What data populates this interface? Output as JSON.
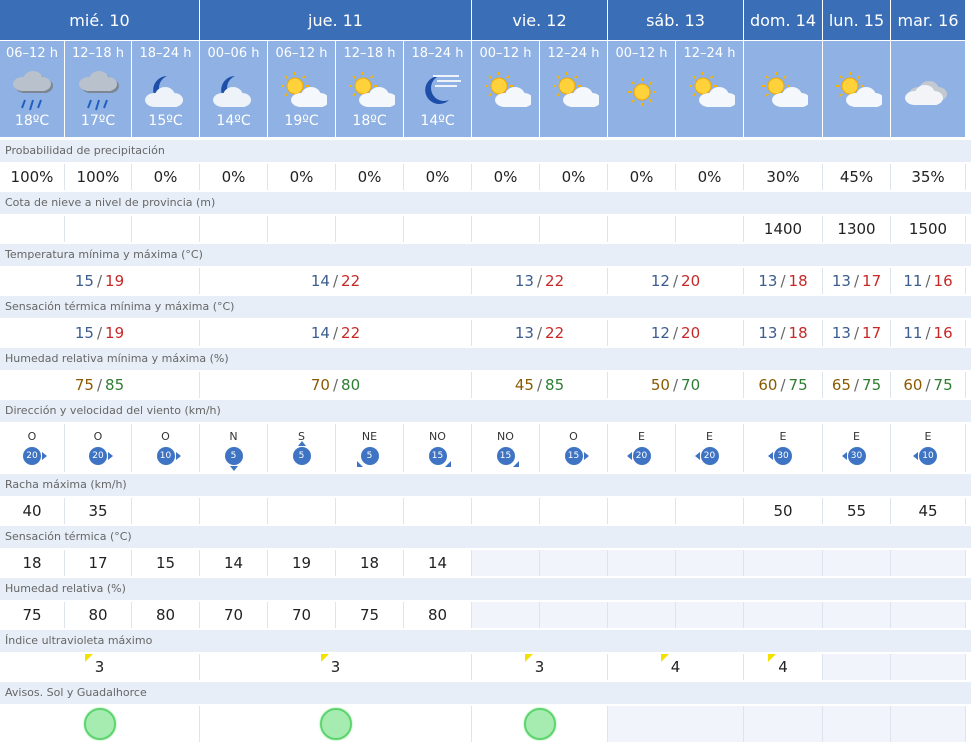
{
  "days": [
    {
      "label": "mié. 10"
    },
    {
      "label": "jue. 11"
    },
    {
      "label": "vie. 12"
    },
    {
      "label": "sáb. 13"
    },
    {
      "label": "dom. 14"
    },
    {
      "label": "lun. 15"
    },
    {
      "label": "mar. 16"
    }
  ],
  "periods": [
    {
      "label": "06–12 h",
      "temp": "18ºC",
      "icon": "rain-cloud-icon"
    },
    {
      "label": "12–18 h",
      "temp": "17ºC",
      "icon": "rain-cloud-icon"
    },
    {
      "label": "18–24 h",
      "temp": "15ºC",
      "icon": "moon-cloud-icon"
    },
    {
      "label": "00–06 h",
      "temp": "14ºC",
      "icon": "moon-cloud-icon"
    },
    {
      "label": "06–12 h",
      "temp": "19ºC",
      "icon": "sun-cloud-icon"
    },
    {
      "label": "12–18 h",
      "temp": "18ºC",
      "icon": "sun-cloud-icon"
    },
    {
      "label": "18–24 h",
      "temp": "14ºC",
      "icon": "moon-haze-icon"
    },
    {
      "label": "00–12 h",
      "temp": "",
      "icon": "sun-cloud-icon"
    },
    {
      "label": "12–24 h",
      "temp": "",
      "icon": "sun-cloud-icon"
    },
    {
      "label": "00–12 h",
      "temp": "",
      "icon": "sun-icon"
    },
    {
      "label": "12–24 h",
      "temp": "",
      "icon": "sun-cloud-icon"
    },
    {
      "label": "",
      "temp": "",
      "icon": "sun-cloud-icon"
    },
    {
      "label": "",
      "temp": "",
      "icon": "sun-cloud-icon"
    },
    {
      "label": "",
      "temp": "",
      "icon": "cloud-icon"
    }
  ],
  "labels": {
    "precip": "Probabilidad de precipitación",
    "snow": "Cota de nieve a nivel de provincia (m)",
    "temp": "Temperatura mínima y máxima (°C)",
    "feels": "Sensación térmica mínima y máxima (°C)",
    "hum": "Humedad relativa mínima y máxima (%)",
    "wind": "Dirección y velocidad del viento (km/h)",
    "gust": "Racha máxima (km/h)",
    "feel1": "Sensación térmica (°C)",
    "hum1": "Humedad relativa (%)",
    "uv": "Índice ultravioleta máximo",
    "alerts": "Avisos. Sol y Guadalhorce"
  },
  "precip": [
    "100%",
    "100%",
    "0%",
    "0%",
    "0%",
    "0%",
    "0%",
    "0%",
    "0%",
    "0%",
    "0%",
    "30%",
    "45%",
    "35%"
  ],
  "snow": [
    "",
    "",
    "",
    "",
    "",
    "",
    "",
    "",
    "",
    "",
    "",
    "1400",
    "1300",
    "1500"
  ],
  "temp": [
    {
      "min": "15",
      "max": "19"
    },
    {
      "min": "14",
      "max": "22"
    },
    {
      "min": "13",
      "max": "22"
    },
    {
      "min": "12",
      "max": "20"
    },
    {
      "min": "13",
      "max": "18"
    },
    {
      "min": "13",
      "max": "17"
    },
    {
      "min": "11",
      "max": "16"
    }
  ],
  "feels": [
    {
      "min": "15",
      "max": "19"
    },
    {
      "min": "14",
      "max": "22"
    },
    {
      "min": "13",
      "max": "22"
    },
    {
      "min": "12",
      "max": "20"
    },
    {
      "min": "13",
      "max": "18"
    },
    {
      "min": "13",
      "max": "17"
    },
    {
      "min": "11",
      "max": "16"
    }
  ],
  "hum": [
    {
      "min": "75",
      "max": "85"
    },
    {
      "min": "70",
      "max": "80"
    },
    {
      "min": "45",
      "max": "85"
    },
    {
      "min": "50",
      "max": "70"
    },
    {
      "min": "60",
      "max": "75"
    },
    {
      "min": "65",
      "max": "75"
    },
    {
      "min": "60",
      "max": "75"
    }
  ],
  "wind": [
    {
      "dir": "O",
      "speed": "20"
    },
    {
      "dir": "O",
      "speed": "20"
    },
    {
      "dir": "O",
      "speed": "10"
    },
    {
      "dir": "N",
      "speed": "5"
    },
    {
      "dir": "S",
      "speed": "5"
    },
    {
      "dir": "NE",
      "speed": "5"
    },
    {
      "dir": "NO",
      "speed": "15"
    },
    {
      "dir": "NO",
      "speed": "15"
    },
    {
      "dir": "O",
      "speed": "15"
    },
    {
      "dir": "E",
      "speed": "20"
    },
    {
      "dir": "E",
      "speed": "20"
    },
    {
      "dir": "E",
      "speed": "30"
    },
    {
      "dir": "E",
      "speed": "30"
    },
    {
      "dir": "E",
      "speed": "10"
    }
  ],
  "gust": [
    "40",
    "35",
    "",
    "",
    "",
    "",
    "",
    "",
    "",
    "",
    "",
    "50",
    "55",
    "45"
  ],
  "feel1": [
    "18",
    "17",
    "15",
    "14",
    "19",
    "18",
    "14",
    "",
    "",
    "",
    "",
    "",
    "",
    ""
  ],
  "hum1": [
    "75",
    "80",
    "80",
    "70",
    "70",
    "75",
    "80",
    "",
    "",
    "",
    "",
    "",
    "",
    ""
  ],
  "uv": [
    "3",
    "3",
    "3",
    "4",
    "4",
    "",
    ""
  ],
  "alerts": [
    "green",
    "green",
    "green",
    "",
    "",
    "",
    ""
  ]
}
